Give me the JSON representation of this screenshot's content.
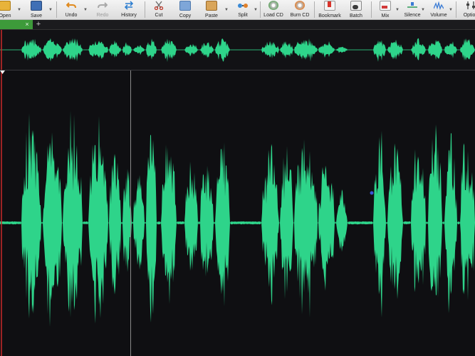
{
  "toolbar": {
    "items": [
      {
        "label": "Open",
        "icon": "folder-open-icon",
        "enabled": true
      },
      {
        "label": "Save",
        "icon": "floppy-disk-icon",
        "enabled": true
      },
      {
        "label": "Undo",
        "icon": "undo-arrow-icon",
        "enabled": true
      },
      {
        "label": "Redo",
        "icon": "redo-arrow-icon",
        "enabled": false
      },
      {
        "label": "History",
        "icon": "history-icon",
        "enabled": true
      },
      {
        "label": "Cut",
        "icon": "scissors-icon",
        "enabled": true
      },
      {
        "label": "Copy",
        "icon": "copy-pages-icon",
        "enabled": true
      },
      {
        "label": "Paste",
        "icon": "clipboard-icon",
        "enabled": true
      },
      {
        "label": "Split",
        "icon": "split-icon",
        "enabled": true
      },
      {
        "label": "Load CD",
        "icon": "load-cd-icon",
        "enabled": true
      },
      {
        "label": "Burn CD",
        "icon": "burn-cd-icon",
        "enabled": true
      },
      {
        "label": "Bookmark",
        "icon": "bookmark-icon",
        "enabled": true
      },
      {
        "label": "Batch",
        "icon": "batch-icon",
        "enabled": true
      },
      {
        "label": "Mix",
        "icon": "mix-icon",
        "enabled": true
      },
      {
        "label": "Silence",
        "icon": "silence-icon",
        "enabled": true
      },
      {
        "label": "Volume",
        "icon": "volume-icon",
        "enabled": true
      },
      {
        "label": "Option",
        "icon": "options-icon",
        "enabled": true
      }
    ]
  },
  "tabs": {
    "close_glyph": "×",
    "add_glyph": "+"
  },
  "colors": {
    "waveform": "#2ed48a",
    "background": "#0f0f12",
    "active_tab": "#3d9a3a",
    "playhead": "#cc2a2a"
  }
}
